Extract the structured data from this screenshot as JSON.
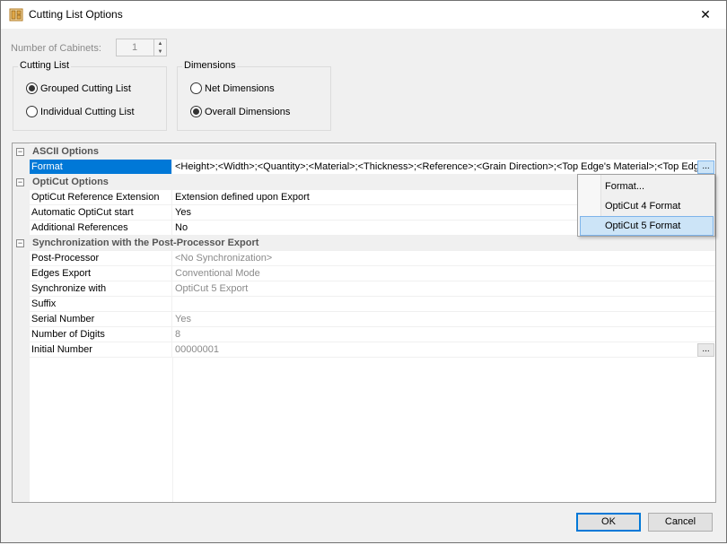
{
  "window": {
    "title": "Cutting List Options",
    "close_glyph": "✕",
    "icon": "cutting-list-icon"
  },
  "cabinets": {
    "label": "Number of Cabinets:",
    "value": "1"
  },
  "cutting_list": {
    "title": "Cutting List",
    "options": [
      {
        "label": "Grouped Cutting List",
        "checked": true
      },
      {
        "label": "Individual Cutting List",
        "checked": false
      }
    ]
  },
  "dimensions": {
    "title": "Dimensions",
    "options": [
      {
        "label": "Net Dimensions",
        "checked": false
      },
      {
        "label": "Overall Dimensions",
        "checked": true
      }
    ]
  },
  "grid": {
    "categories": {
      "ascii": "ASCII Options",
      "opticut": "OptiCut Options",
      "sync": "Synchronization with the Post-Processor Export"
    },
    "toggle_glyph": "−",
    "ellipsis": "...",
    "ascii": {
      "format": {
        "name": "Format",
        "value": "<Height>;<Width>;<Quantity>;<Material>;<Thickness>;<Reference>;<Grain Direction>;<Top Edge's Material>;<Top Edge's Thickness>"
      }
    },
    "opticut": [
      {
        "name": "OptiCut Reference Extension",
        "value": "Extension defined upon Export"
      },
      {
        "name": "Automatic OptiCut start",
        "value": "Yes"
      },
      {
        "name": "Additional References",
        "value": "No"
      }
    ],
    "sync": [
      {
        "name": "Post-Processor",
        "value": "<No Synchronization>"
      },
      {
        "name": "Edges Export",
        "value": "Conventional Mode"
      },
      {
        "name": "Synchronize with",
        "value": "OptiCut 5 Export"
      },
      {
        "name": "Suffix",
        "value": ""
      },
      {
        "name": "Serial Number",
        "value": "Yes"
      },
      {
        "name": "Number of Digits",
        "value": "8"
      },
      {
        "name": "Initial Number",
        "value": "00000001"
      }
    ]
  },
  "dropdown": {
    "items": [
      {
        "label": "Format..."
      },
      {
        "label": "OptiCut 4 Format"
      },
      {
        "label": "OptiCut 5 Format",
        "highlighted": true
      }
    ]
  },
  "buttons": {
    "ok": "OK",
    "cancel": "Cancel"
  },
  "colors": {
    "selection": "#0078d7",
    "menu_highlight": "#cce4f7"
  }
}
